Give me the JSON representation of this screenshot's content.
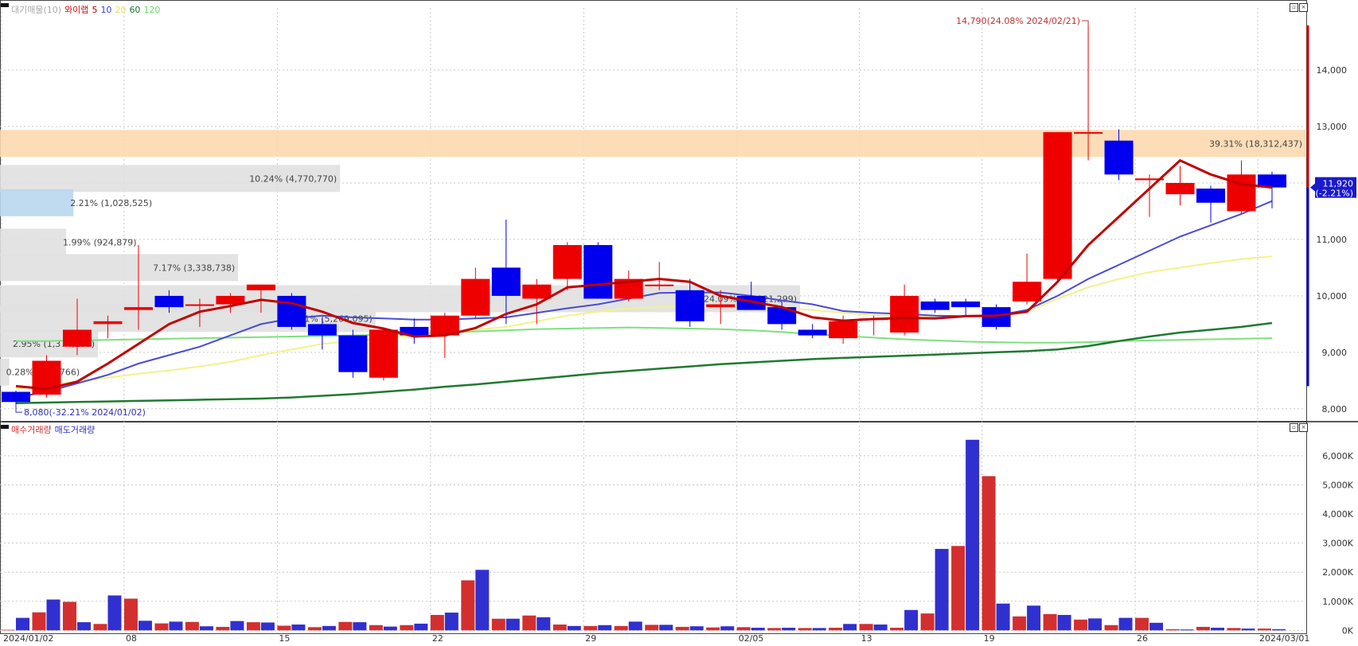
{
  "price_legend": {
    "items": [
      {
        "label": "대기매물(10)",
        "color": "#aaaaaa"
      },
      {
        "label": "와이랩",
        "color": "#d01010"
      },
      {
        "label": "5",
        "color": "#c00000"
      },
      {
        "label": "10",
        "color": "#3b3bd6"
      },
      {
        "label": "20",
        "color": "#e8e88a"
      },
      {
        "label": "60",
        "color": "#1a7a2a"
      },
      {
        "label": "120",
        "color": "#66dd66"
      }
    ]
  },
  "volume_legend": {
    "items": [
      {
        "label": "매수거래량",
        "color": "#d32f2f"
      },
      {
        "label": "매도거래량",
        "color": "#3030d0"
      }
    ]
  },
  "annotations": {
    "high": "14,790(24.08% 2024/02/21)",
    "low": "8,080(-32.21% 2024/01/02)",
    "current_price": "11,920",
    "current_change": "(-2.21%)"
  },
  "colors": {
    "up": "#ee0000",
    "down": "#0000ee",
    "ma5": "#c00000",
    "ma10": "#4a4ad8",
    "ma20": "#f2f28a",
    "ma60": "#1f7a30",
    "ma120": "#7ee07e",
    "buy_vol": "#d32f2f",
    "sell_vol": "#3030d0",
    "highlight_band": "#fcd9b0",
    "gray_band": "#e0e0e0",
    "blue_band": "#b9d7ee"
  },
  "chart_data": [
    {
      "type": "candlestick",
      "x_ticks": [
        "2024/01/02",
        "08",
        "15",
        "22",
        "29",
        "02/05",
        "13",
        "19",
        "26",
        "2024/03/01"
      ],
      "y_ticks": [
        "8,000",
        "9,000",
        "10,000",
        "11,000",
        "12,000",
        "13,000",
        "14,000"
      ],
      "ylim": [
        7800,
        15100
      ],
      "candles": [
        {
          "o": 8300,
          "h": 8320,
          "l": 8080,
          "c": 8120
        },
        {
          "o": 8250,
          "h": 8950,
          "l": 8200,
          "c": 8850
        },
        {
          "o": 9100,
          "h": 9950,
          "l": 8950,
          "c": 9400
        },
        {
          "o": 9500,
          "h": 9650,
          "l": 9250,
          "c": 9550
        },
        {
          "o": 9750,
          "h": 10900,
          "l": 9400,
          "c": 9800
        },
        {
          "o": 10000,
          "h": 10100,
          "l": 9700,
          "c": 9800
        },
        {
          "o": 9850,
          "h": 9950,
          "l": 9450,
          "c": 9850
        },
        {
          "o": 9850,
          "h": 10050,
          "l": 9700,
          "c": 10000
        },
        {
          "o": 10100,
          "h": 10200,
          "l": 9700,
          "c": 10200
        },
        {
          "o": 10000,
          "h": 10050,
          "l": 9400,
          "c": 9450
        },
        {
          "o": 9500,
          "h": 9600,
          "l": 9050,
          "c": 9300
        },
        {
          "o": 9300,
          "h": 9400,
          "l": 8550,
          "c": 8650
        },
        {
          "o": 8550,
          "h": 9400,
          "l": 8500,
          "c": 9400
        },
        {
          "o": 9450,
          "h": 9600,
          "l": 9150,
          "c": 9300
        },
        {
          "o": 9300,
          "h": 9700,
          "l": 8900,
          "c": 9650
        },
        {
          "o": 9650,
          "h": 10500,
          "l": 9600,
          "c": 10300
        },
        {
          "o": 10500,
          "h": 11350,
          "l": 9500,
          "c": 10000
        },
        {
          "o": 9950,
          "h": 10300,
          "l": 9500,
          "c": 10200
        },
        {
          "o": 10300,
          "h": 10950,
          "l": 10100,
          "c": 10900
        },
        {
          "o": 10900,
          "h": 10950,
          "l": 9950,
          "c": 9950
        },
        {
          "o": 9950,
          "h": 10450,
          "l": 9900,
          "c": 10300
        },
        {
          "o": 10200,
          "h": 10600,
          "l": 10100,
          "c": 10200
        },
        {
          "o": 10100,
          "h": 10300,
          "l": 9450,
          "c": 9550
        },
        {
          "o": 9800,
          "h": 10100,
          "l": 9500,
          "c": 9850
        },
        {
          "o": 10000,
          "h": 10250,
          "l": 9750,
          "c": 9750
        },
        {
          "o": 9800,
          "h": 9900,
          "l": 9400,
          "c": 9500
        },
        {
          "o": 9400,
          "h": 9500,
          "l": 9250,
          "c": 9300
        },
        {
          "o": 9250,
          "h": 9650,
          "l": 9150,
          "c": 9550
        },
        {
          "o": 9600,
          "h": 9650,
          "l": 9300,
          "c": 9600
        },
        {
          "o": 9350,
          "h": 10200,
          "l": 9300,
          "c": 10000
        },
        {
          "o": 9900,
          "h": 9950,
          "l": 9700,
          "c": 9750
        },
        {
          "o": 9900,
          "h": 9950,
          "l": 9650,
          "c": 9800
        },
        {
          "o": 9800,
          "h": 9850,
          "l": 9400,
          "c": 9450
        },
        {
          "o": 9900,
          "h": 10750,
          "l": 9850,
          "c": 10250
        },
        {
          "o": 10300,
          "h": 12900,
          "l": 10250,
          "c": 12900
        },
        {
          "o": 12880,
          "h": 14790,
          "l": 12400,
          "c": 12900
        },
        {
          "o": 12750,
          "h": 12950,
          "l": 12050,
          "c": 12150
        },
        {
          "o": 12050,
          "h": 12150,
          "l": 11400,
          "c": 12080
        },
        {
          "o": 11800,
          "h": 12300,
          "l": 11600,
          "c": 12000
        },
        {
          "o": 11900,
          "h": 11950,
          "l": 11300,
          "c": 11650
        },
        {
          "o": 11500,
          "h": 12400,
          "l": 11450,
          "c": 12150
        },
        {
          "o": 12150,
          "h": 12200,
          "l": 11550,
          "c": 11920
        }
      ],
      "ma5": [
        8400,
        8350,
        8480,
        8800,
        9150,
        9500,
        9720,
        9820,
        9930,
        9870,
        9720,
        9520,
        9420,
        9280,
        9300,
        9430,
        9680,
        9850,
        10150,
        10200,
        10250,
        10300,
        10250,
        10000,
        9900,
        9800,
        9620,
        9560,
        9590,
        9610,
        9600,
        9640,
        9650,
        9720,
        10250,
        10900,
        11400,
        11900,
        12400,
        12150,
        11980,
        11920
      ],
      "ma10": [
        8200,
        8300,
        8450,
        8600,
        8800,
        8950,
        9100,
        9300,
        9500,
        9600,
        9650,
        9620,
        9600,
        9580,
        9580,
        9600,
        9620,
        9700,
        9780,
        9850,
        9950,
        10050,
        10060,
        10060,
        10000,
        9920,
        9850,
        9730,
        9700,
        9680,
        9650,
        9640,
        9650,
        9750,
        10000,
        10300,
        10550,
        10800,
        11050,
        11250,
        11450,
        11680
      ],
      "ma20": [
        8350,
        8420,
        8480,
        8550,
        8620,
        8680,
        8750,
        8830,
        8950,
        9050,
        9150,
        9200,
        9250,
        9300,
        9350,
        9400,
        9450,
        9550,
        9650,
        9720,
        9780,
        9800,
        9820,
        9820,
        9800,
        9780,
        9750,
        9700,
        9660,
        9640,
        9620,
        9640,
        9660,
        9720,
        9950,
        10150,
        10300,
        10420,
        10500,
        10580,
        10650,
        10700
      ],
      "ma60": [
        8100,
        8110,
        8120,
        8130,
        8140,
        8150,
        8160,
        8170,
        8180,
        8200,
        8230,
        8260,
        8300,
        8340,
        8390,
        8430,
        8480,
        8530,
        8580,
        8630,
        8670,
        8710,
        8750,
        8790,
        8820,
        8850,
        8880,
        8900,
        8920,
        8940,
        8960,
        8980,
        9000,
        9020,
        9050,
        9110,
        9200,
        9280,
        9350,
        9400,
        9450,
        9520
      ],
      "ma120": [
        9200,
        9200,
        9210,
        9220,
        9230,
        9240,
        9250,
        9260,
        9270,
        9280,
        9290,
        9300,
        9310,
        9330,
        9350,
        9370,
        9390,
        9410,
        9420,
        9430,
        9440,
        9430,
        9420,
        9410,
        9390,
        9360,
        9320,
        9290,
        9260,
        9230,
        9210,
        9190,
        9180,
        9170,
        9170,
        9180,
        9200,
        9210,
        9220,
        9230,
        9240,
        9250
      ]
    },
    {
      "type": "bar",
      "ylabel": "",
      "y_ticks": [
        "0K",
        "1,000K",
        "2,000K",
        "3,000K",
        "4,000K",
        "5,000K",
        "6,000K"
      ],
      "ylim": [
        -100,
        6900
      ],
      "series": [
        {
          "name": "매수거래량",
          "values": [
            20,
            620,
            980,
            220,
            1090,
            240,
            290,
            120,
            280,
            160,
            110,
            290,
            180,
            180,
            530,
            1720,
            400,
            510,
            200,
            150,
            150,
            190,
            120,
            100,
            110,
            80,
            80,
            90,
            220,
            90,
            580,
            2900,
            5300,
            480,
            560,
            370,
            180,
            430,
            40,
            120,
            80,
            60
          ]
        },
        {
          "name": "매도거래량",
          "values": [
            430,
            1060,
            280,
            1200,
            330,
            300,
            140,
            320,
            270,
            200,
            150,
            280,
            130,
            230,
            610,
            2080,
            400,
            450,
            150,
            180,
            300,
            190,
            140,
            140,
            90,
            90,
            80,
            220,
            200,
            700,
            2800,
            6550,
            920,
            850,
            530,
            410,
            430,
            260,
            30,
            90,
            60,
            40
          ]
        }
      ]
    }
  ],
  "volume_profile": [
    {
      "label": "39.31% (18,312,437)"
    },
    {
      "label": "10.24% (4,770,770)"
    },
    {
      "label": "2.21% (1,028,525)"
    },
    {
      "label": "1.99% (924,879)"
    },
    {
      "label": "7.17% (3,338,738)"
    },
    {
      "label": "24.09% (11,221,299)"
    },
    {
      "label": "11.31% (5,269,095)"
    },
    {
      "label": "2.95% (1,374,259)"
    },
    {
      "label": "0.28% (131,766)"
    }
  ]
}
